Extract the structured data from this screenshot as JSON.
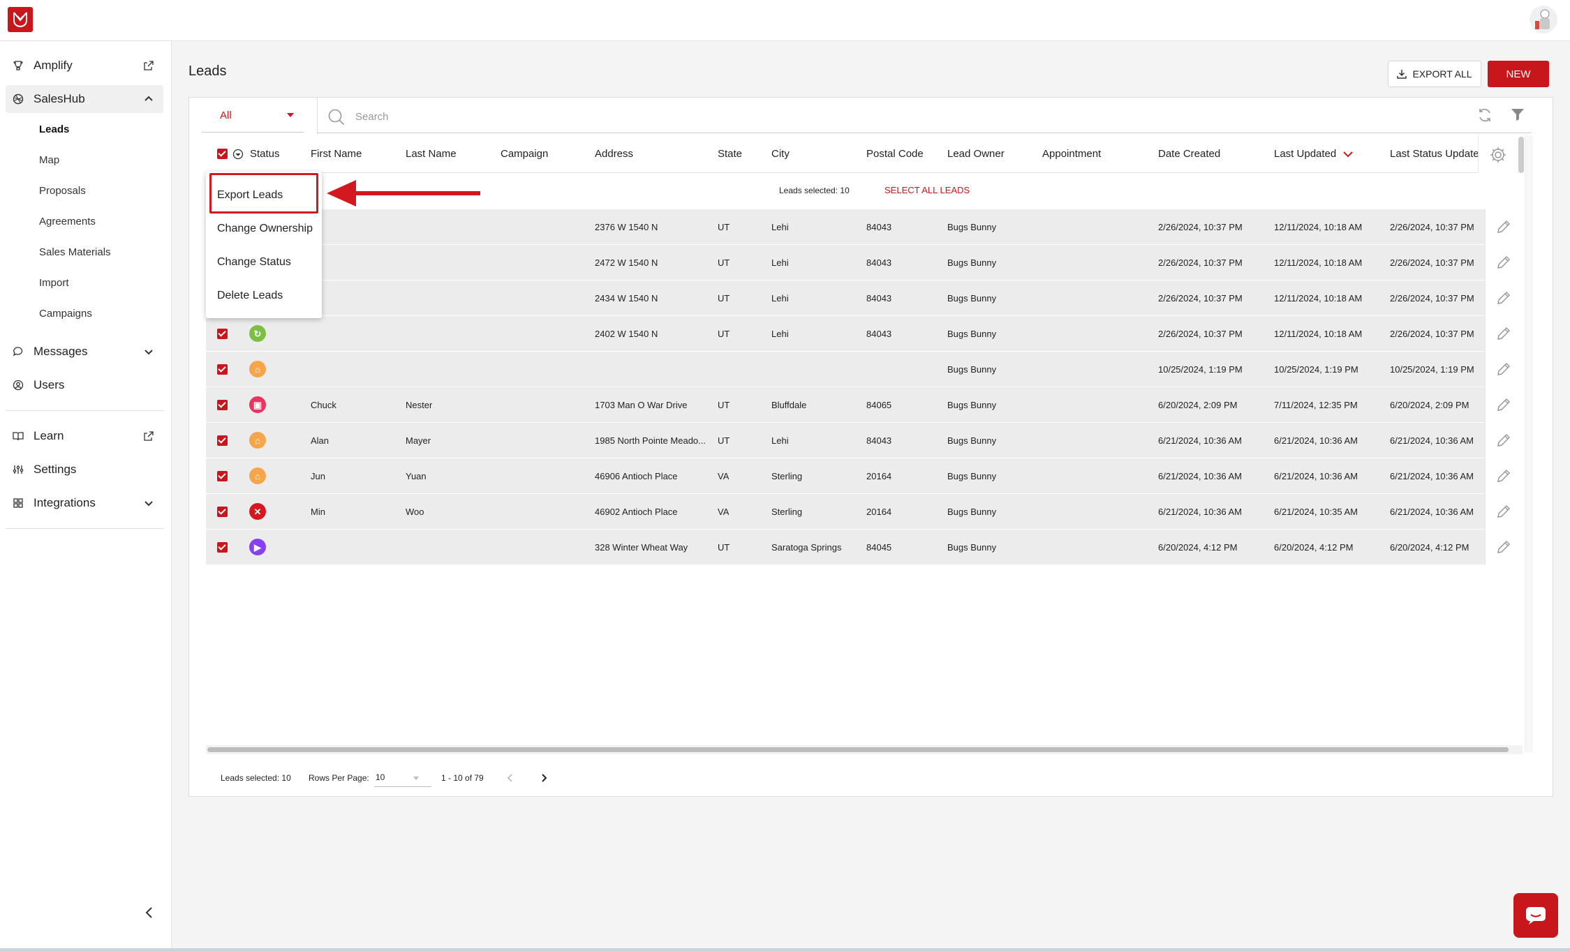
{
  "colors": {
    "accent": "#c8161d",
    "row_bg": "#ececec"
  },
  "sidebar": {
    "amplify": "Amplify",
    "saleshub": "SalesHub",
    "sub_items": [
      "Leads",
      "Map",
      "Proposals",
      "Agreements",
      "Sales Materials",
      "Import",
      "Campaigns"
    ],
    "messages": "Messages",
    "users": "Users",
    "learn": "Learn",
    "settings": "Settings",
    "integrations": "Integrations"
  },
  "header": {
    "title": "Leads",
    "export_all": "EXPORT ALL",
    "new": "NEW"
  },
  "toolbar": {
    "filter_value": "All",
    "search_placeholder": "Search"
  },
  "table": {
    "columns": [
      "Status",
      "First Name",
      "Last Name",
      "Campaign",
      "Address",
      "State",
      "City",
      "Postal Code",
      "Lead Owner",
      "Appointment",
      "Date Created",
      "Last Updated",
      "Last Status Update"
    ],
    "sort_column": "Last Updated",
    "selection_text": "Leads selected: 10",
    "select_all": "SELECT ALL LEADS",
    "rows": [
      {
        "status": "",
        "first": "",
        "last": "",
        "address": "2376 W 1540 N",
        "state": "UT",
        "city": "Lehi",
        "postal": "84043",
        "owner": "Bugs Bunny",
        "created": "2/26/2024, 10:37 PM",
        "updated": "12/11/2024, 10:18 AM",
        "status_update": "2/26/2024, 10:37 PM"
      },
      {
        "status": "",
        "first": "",
        "last": "",
        "address": "2472 W 1540 N",
        "state": "UT",
        "city": "Lehi",
        "postal": "84043",
        "owner": "Bugs Bunny",
        "created": "2/26/2024, 10:37 PM",
        "updated": "12/11/2024, 10:18 AM",
        "status_update": "2/26/2024, 10:37 PM"
      },
      {
        "status": "",
        "first": "",
        "last": "",
        "address": "2434 W 1540 N",
        "state": "UT",
        "city": "Lehi",
        "postal": "84043",
        "owner": "Bugs Bunny",
        "created": "2/26/2024, 10:37 PM",
        "updated": "12/11/2024, 10:18 AM",
        "status_update": "2/26/2024, 10:37 PM"
      },
      {
        "status": "refresh",
        "first": "",
        "last": "",
        "address": "2402 W 1540 N",
        "state": "UT",
        "city": "Lehi",
        "postal": "84043",
        "owner": "Bugs Bunny",
        "created": "2/26/2024, 10:37 PM",
        "updated": "12/11/2024, 10:18 AM",
        "status_update": "2/26/2024, 10:37 PM"
      },
      {
        "status": "home",
        "first": "",
        "last": "",
        "address": "",
        "state": "",
        "city": "",
        "postal": "",
        "owner": "Bugs Bunny",
        "created": "10/25/2024, 1:19 PM",
        "updated": "10/25/2024, 1:19 PM",
        "status_update": "10/25/2024, 1:19 PM"
      },
      {
        "status": "calendar",
        "first": "Chuck",
        "last": "Nester",
        "address": "1703 Man O War Drive",
        "state": "UT",
        "city": "Bluffdale",
        "postal": "84065",
        "owner": "Bugs Bunny",
        "created": "6/20/2024, 2:09 PM",
        "updated": "7/11/2024, 12:35 PM",
        "status_update": "6/20/2024, 2:09 PM"
      },
      {
        "status": "home",
        "first": "Alan",
        "last": "Mayer",
        "address": "1985 North Pointe Meado...",
        "state": "UT",
        "city": "Lehi",
        "postal": "84043",
        "owner": "Bugs Bunny",
        "created": "6/21/2024, 10:36 AM",
        "updated": "6/21/2024, 10:36 AM",
        "status_update": "6/21/2024, 10:36 AM"
      },
      {
        "status": "home",
        "first": "Jun",
        "last": "Yuan",
        "address": "46906 Antioch Place",
        "state": "VA",
        "city": "Sterling",
        "postal": "20164",
        "owner": "Bugs Bunny",
        "created": "6/21/2024, 10:36 AM",
        "updated": "6/21/2024, 10:36 AM",
        "status_update": "6/21/2024, 10:36 AM"
      },
      {
        "status": "x",
        "first": "Min",
        "last": "Woo",
        "address": "46902 Antioch Place",
        "state": "VA",
        "city": "Sterling",
        "postal": "20164",
        "owner": "Bugs Bunny",
        "created": "6/21/2024, 10:36 AM",
        "updated": "6/21/2024, 10:35 AM",
        "status_update": "6/21/2024, 10:36 AM"
      },
      {
        "status": "truck",
        "first": "",
        "last": "",
        "address": "328 Winter Wheat Way",
        "state": "UT",
        "city": "Saratoga Springs",
        "postal": "84045",
        "owner": "Bugs Bunny",
        "created": "6/20/2024, 4:12 PM",
        "updated": "6/20/2024, 4:12 PM",
        "status_update": "6/20/2024, 4:12 PM"
      }
    ]
  },
  "status_colors": {
    "refresh": "#7bc043",
    "home": "#f5a54a",
    "calendar": "#e8345e",
    "x": "#d3181f",
    "truck": "#8a3ff0"
  },
  "footer": {
    "selected": "Leads selected: 10",
    "rows_per_page_label": "Rows Per Page:",
    "rows_per_page": "10",
    "range": "1 - 10 of 79"
  },
  "menu": {
    "items": [
      "Export Leads",
      "Change Ownership",
      "Change Status",
      "Delete Leads"
    ]
  }
}
